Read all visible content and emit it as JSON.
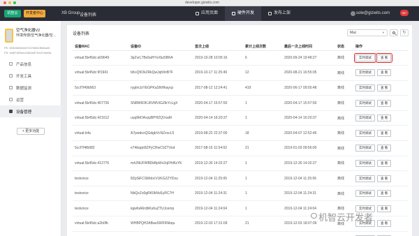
{
  "browser": {
    "url": "developer.gizwits.com",
    "colors": [
      "#fc5f57",
      "#fdbc2e",
      "#28c840"
    ]
  },
  "topnav": {
    "logo": "机智云",
    "center": "开发者中心",
    "group": "XB Group",
    "group_tag": "设备列表",
    "tabs": [
      {
        "label": "应用页面",
        "icon": "app-icon"
      },
      {
        "label": "硬件开发",
        "icon": "chip-icon"
      },
      {
        "label": "发布上架",
        "icon": "publish-icon"
      }
    ],
    "user": "sole@gizwits.com",
    "badge": "99+"
  },
  "sidebar": {
    "product_name": "空气净化器V2",
    "product_desc": "环境传感/空气净化器/空…",
    "pk_label": "PK: 603e6b0b6eb7437e8813ffa5ae6",
    "ps_label": "PS: 4e8f7d29aec4483e871b1f7d6e9a",
    "items": [
      {
        "label": "产品信息"
      },
      {
        "label": "开发工具"
      },
      {
        "label": "数据监测"
      },
      {
        "label": "运营"
      },
      {
        "label": "设备管理"
      }
    ],
    "more_label": "+ 更多功能"
  },
  "main": {
    "title": "设备列表",
    "filter_value": "Mac",
    "refresh_icon": "refresh-icon",
    "columns": [
      "设备MAC",
      "设备ID",
      "首次上线",
      "累计上线次数",
      "最后一次上线时间",
      "状态",
      "操作"
    ],
    "action_labels": {
      "debug": "实时调试",
      "view": "查 看"
    },
    "rows": [
      {
        "mac": "virtual:5b45dc:a09649",
        "did": "3pZvrL7Bs9aHYnXbz5BfrA",
        "first": "2019-10-28 10:05:16",
        "count": "6",
        "last": "2020-09-24 19:48:27",
        "status": "离线"
      },
      {
        "mac": "virtual:5b45dc:9f1941",
        "did": "bKxQ5Ok2RkQwJqh9nB7F",
        "first": "2019-10-17 11:25:49",
        "count": "12",
        "last": "2020-08-21 16:55:05",
        "status": "离线"
      },
      {
        "mac": "5ccf7f49b963",
        "did": "rygtmJzYEGPKaSNHkaycp",
        "first": "2017-08-12 12:24:41",
        "count": "419",
        "last": "2020-06-17 09:05:48",
        "status": "离线"
      },
      {
        "mac": "virtual:5b45dc:407726",
        "did": "SN8W6OKJ6VMVtGZtkYcLgX",
        "first": "2020-04-17 15:57:50",
        "count": "1",
        "last": "2020-04-17 15:57:50",
        "status": "离线"
      },
      {
        "mac": "virtual:5b45dc:421612",
        "did": "uuqMrDAxzpBPHZQVxaM",
        "first": "2020-04-14 16:20:37",
        "count": "1",
        "last": "2020-04-14 16:20:37",
        "status": "离线"
      },
      {
        "mac": "virtual:lofa",
        "did": "A7pwdoxQGdgbVcNZzxcL5",
        "first": "2019-08-22 22:37:00",
        "count": "18",
        "last": "2020-04-07 12:52:46",
        "status": "离线"
      },
      {
        "mac": "5ccf7f4fb982",
        "did": "e74bqqrt9ZPyCRwC0ZTVod",
        "first": "2017-08-16 11:54:02",
        "count": "21",
        "last": "2019-01-03 09:56:00",
        "status": "离线"
      },
      {
        "mac": "virtual:5b45dc:412776",
        "did": "m4JNUFWBDkBpWv2qFHrBzYK",
        "first": "2019-12-30 14:32:27",
        "count": "1",
        "last": "2019-12-30 14:32:27",
        "status": "离线"
      },
      {
        "mac": "testvoice",
        "did": "8ZpSiFCSMdocVUKGZZYDxu",
        "first": "2019-12-04 11:25:05",
        "count": "1",
        "last": "2019-12-04 11:25:05",
        "status": "离线"
      },
      {
        "mac": "testvoice",
        "did": "NbQxZo0gRK0kNvEyRC7H",
        "first": "2019-12-04 11:24:31",
        "count": "1",
        "last": "2019-12-04 11:24:31",
        "status": "离线"
      },
      {
        "mac": "testvoice",
        "did": "kgwfoA6rdbKs6uZTUJcemp",
        "first": "2019-12-04 11:24:04",
        "count": "1",
        "last": "2019-12-04 11:24:04",
        "status": "离线"
      },
      {
        "mac": "virtual:5b45dc:a2b0fb",
        "did": "WHBPQH2ABaoSWF6Nbqu",
        "first": "2019-12-03 17:31:09",
        "count": "21",
        "last": "2019-12-03 18:07:09",
        "status": "离线"
      },
      {
        "mac": "virtual:5b45dc:498338",
        "did": "s0UQgbzYVgAwbAyFWoRt0",
        "first": "2019-12-04 15:20:02",
        "count": "1",
        "last": "2019-12-04 15:20:02",
        "status": "离线"
      }
    ]
  },
  "watermark": "机智云开发者"
}
